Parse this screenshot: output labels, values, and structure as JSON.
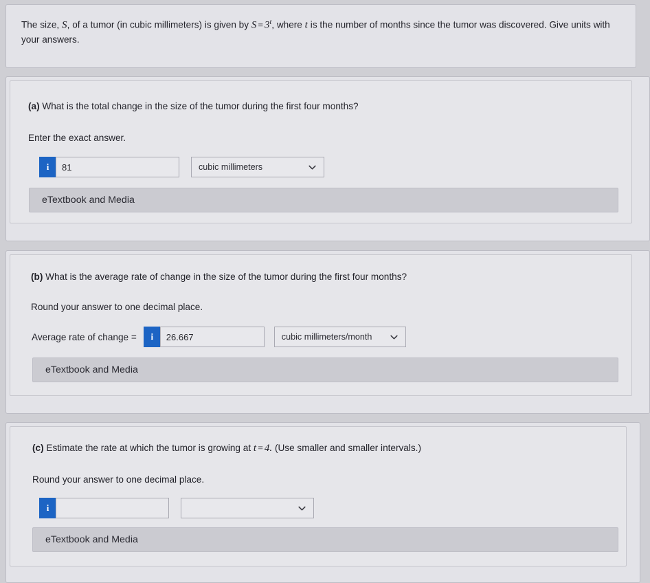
{
  "stem": {
    "part1": "The size, ",
    "var_S": "S",
    "part2": ", of a tumor (in cubic millimeters) is given by ",
    "equation_lhs": "S",
    "equation_eq": "=",
    "equation_base": "3",
    "equation_exp": "t",
    "part3": ", where ",
    "var_t": "t",
    "part4": " is the number of months since the tumor was discovered. Give units with your answers."
  },
  "parts": [
    {
      "id": "a",
      "label": "(a)",
      "question": "What is the total change in the size of the tumor during the first four months?",
      "instruction": "Enter the exact answer.",
      "prefix": "",
      "info_icon": "i",
      "answer_value": "81",
      "answer_placeholder": "",
      "unit_value": "cubic millimeters",
      "unit_placeholder": "",
      "etextbook_label": "eTextbook and Media"
    },
    {
      "id": "b",
      "label": "(b)",
      "question": "What is the average rate of change in the size of the tumor during the first four months?",
      "instruction": "Round your answer to one decimal place.",
      "prefix": "Average rate of change  =",
      "info_icon": "i",
      "answer_value": "26.667",
      "answer_placeholder": "",
      "unit_value": "cubic millimeters/month",
      "unit_placeholder": "",
      "etextbook_label": "eTextbook and Media"
    },
    {
      "id": "c",
      "label": "(c)",
      "question_pre": "Estimate the rate at which the tumor is growing at ",
      "question_var": "t",
      "question_eq": "=",
      "question_val": "4.",
      "question_post": " (Use smaller and smaller intervals.)",
      "instruction": "Round your answer to one decimal place.",
      "prefix": "",
      "info_icon": "i",
      "answer_value": "",
      "answer_placeholder": "",
      "unit_value": "",
      "unit_placeholder": "",
      "etextbook_label": "eTextbook and Media"
    }
  ],
  "colors": {
    "page_background": "#cfcfd4",
    "card_background": "#e3e3e8",
    "inner_panel": "#e6e6ea",
    "info_badge_blue": "#1c64c4",
    "etextbook_bar": "#cbcbd1",
    "text": "#23232a"
  },
  "icons": {
    "chevron_down": "chevron-down-icon",
    "info": "info-icon"
  }
}
